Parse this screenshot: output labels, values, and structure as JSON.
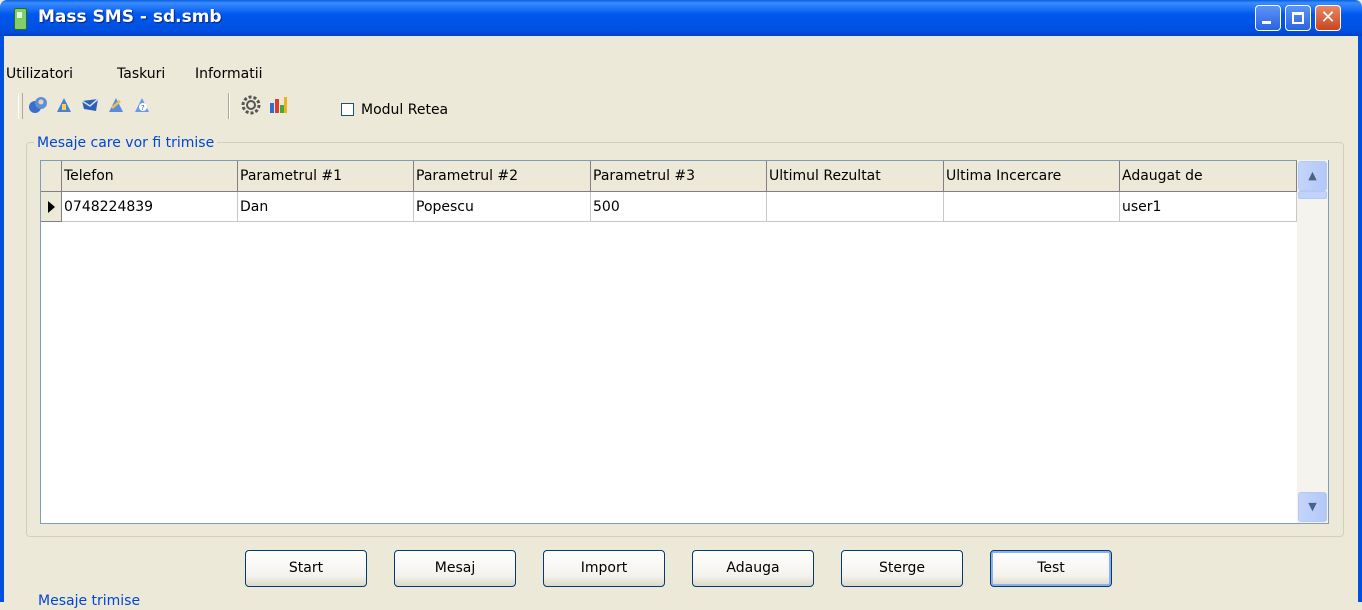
{
  "window": {
    "title": "Mass SMS - sd.smb"
  },
  "menu": [
    "Utilizatori",
    "Taskuri",
    "Informatii"
  ],
  "toolbar": {
    "icons": [
      "users-icon",
      "task-add-icon",
      "mail-icon",
      "task-edit-icon",
      "help-icon",
      "settings-gear-icon",
      "chart-icon"
    ],
    "network_mode": {
      "label": "Modul Retea",
      "checked": false
    }
  },
  "group": {
    "title": "Mesaje care vor fi trimise"
  },
  "table": {
    "columns": [
      "Telefon",
      "Parametrul #1",
      "Parametrul #2",
      "Parametrul #3",
      "Ultimul Rezultat",
      "Ultima Incercare",
      "Adaugat de"
    ],
    "rows": [
      [
        "0748224839",
        "Dan",
        "Popescu",
        "500",
        "",
        "",
        "user1"
      ]
    ]
  },
  "buttons": [
    "Start",
    "Mesaj",
    "Import",
    "Adauga",
    "Sterge",
    "Test"
  ],
  "bottom_label": "Mesaje trimise",
  "colors": {
    "titlebar": "#0058ee",
    "group_title": "#0046d5",
    "window_bg": "#ece9d8"
  }
}
